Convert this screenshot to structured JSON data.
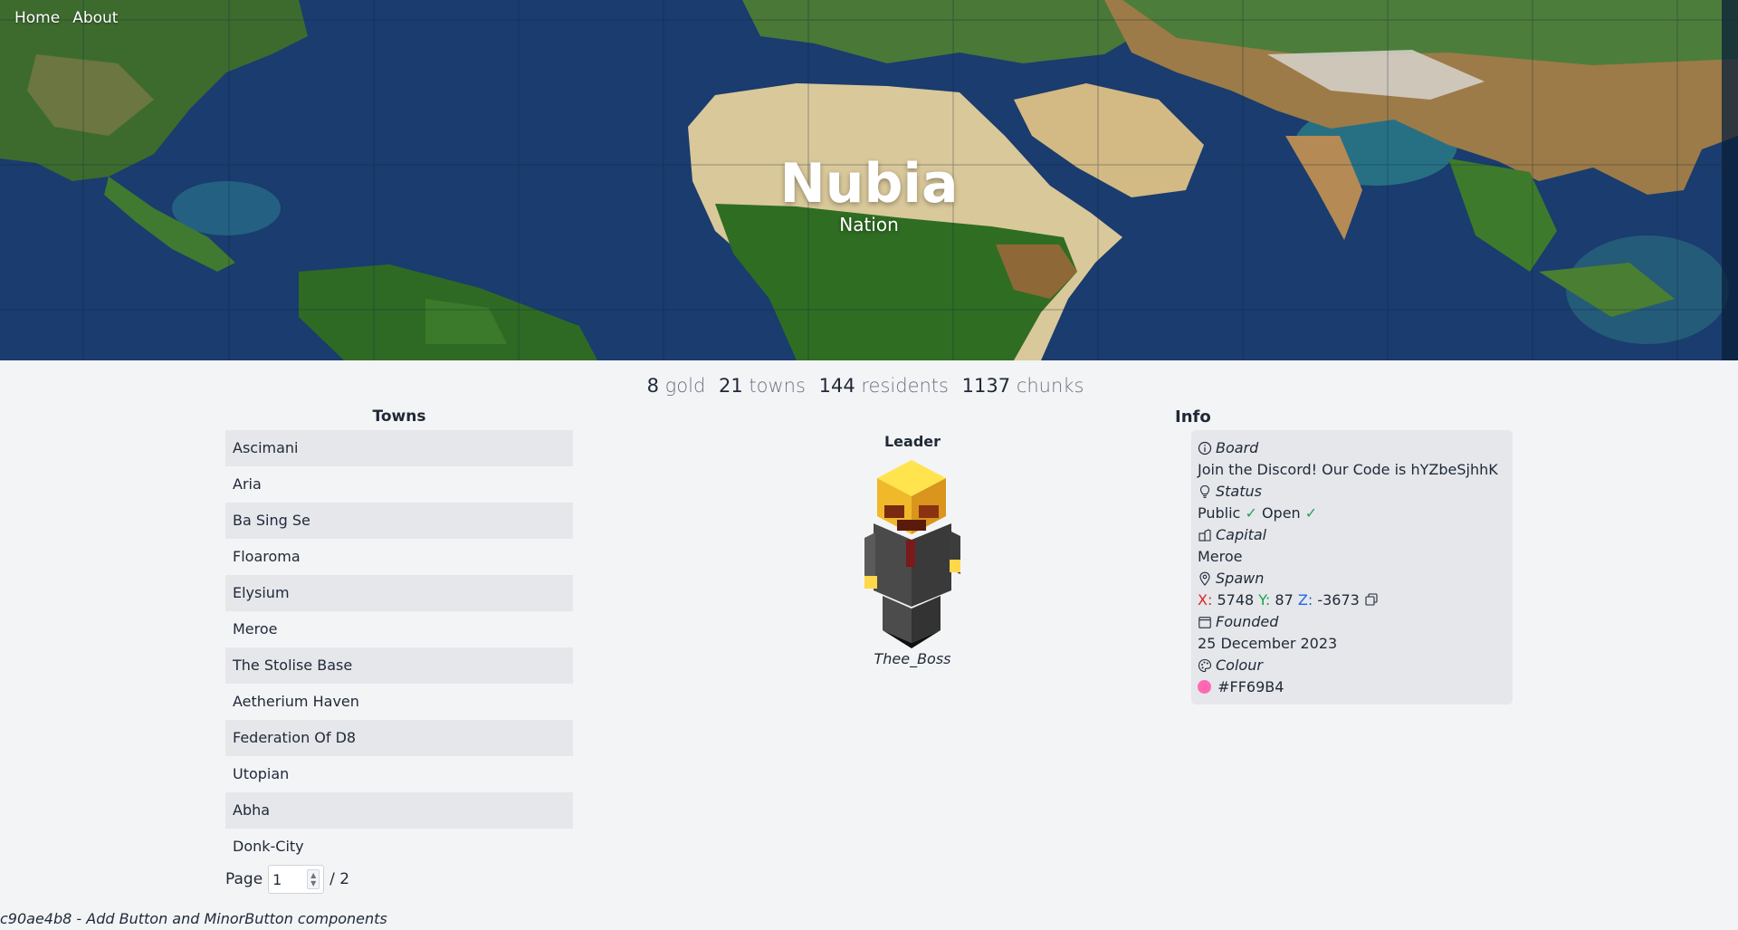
{
  "nav": {
    "home": "Home",
    "about": "About"
  },
  "hero": {
    "title": "Nubia",
    "subtitle": "Nation"
  },
  "stats": {
    "gold_value": "8",
    "gold_label": "gold",
    "towns_value": "21",
    "towns_label": "towns",
    "residents_value": "144",
    "residents_label": "residents",
    "chunks_value": "1137",
    "chunks_label": "chunks"
  },
  "towns": {
    "heading": "Towns",
    "items": [
      "Ascimani",
      "Aria",
      "Ba Sing Se",
      "Floaroma",
      "Elysium",
      "Meroe",
      "The Stolise Base",
      "Aetherium Haven",
      "Federation Of D8",
      "Utopian",
      "Abha",
      "Donk-City"
    ],
    "page_label": "Page",
    "page_value": "1",
    "page_total": "/ 2"
  },
  "leader": {
    "heading": "Leader",
    "name": "Thee_Boss"
  },
  "info": {
    "heading": "Info",
    "board_label": "Board",
    "board_value": "Join the Discord! Our Code is hYZbeSjhhK",
    "status_label": "Status",
    "status_public": "Public",
    "status_open": "Open",
    "check_glyph": "✓",
    "capital_label": "Capital",
    "capital_value": "Meroe",
    "spawn_label": "Spawn",
    "spawn_x_label": "X:",
    "spawn_x": "5748",
    "spawn_y_label": "Y:",
    "spawn_y": "87",
    "spawn_z_label": "Z:",
    "spawn_z": "-3673",
    "founded_label": "Founded",
    "founded_value": "25 December 2023",
    "colour_label": "Colour",
    "colour_value": "#FF69B4",
    "colour_hex": "#FF69B4"
  },
  "footer": {
    "commit": "c90ae4b8 - Add Button and MinorButton components"
  }
}
